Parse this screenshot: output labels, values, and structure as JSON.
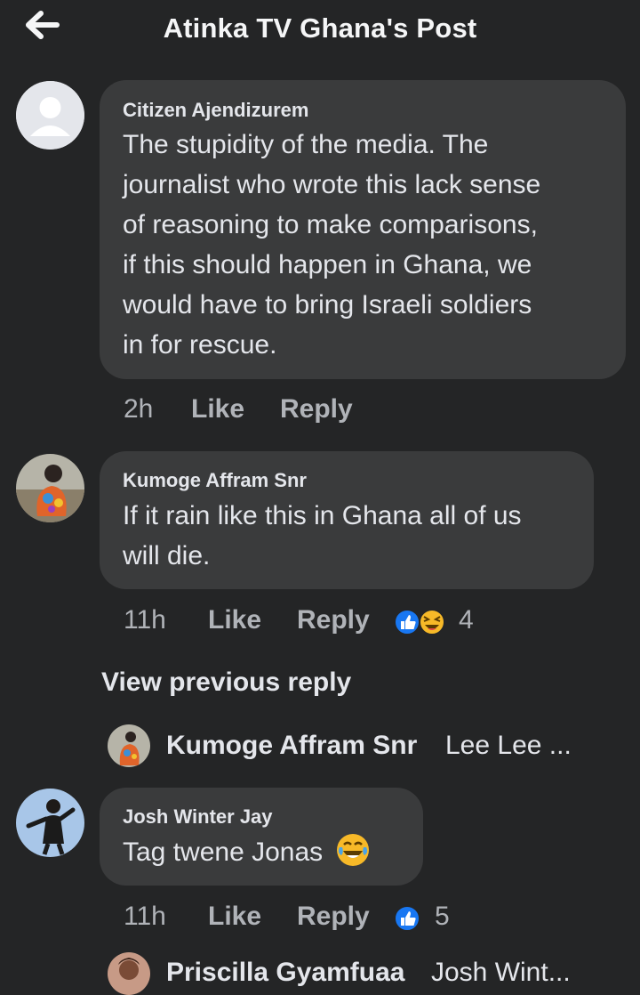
{
  "header": {
    "title": "Atinka TV Ghana's Post",
    "back_icon": "arrow-left-icon"
  },
  "comments": [
    {
      "author": "Citizen Ajendizurem",
      "lines": [
        "The stupidity of the media. The",
        "journalist who wrote this lack sense",
        "of reasoning to make comparisons,",
        "if this should happen in Ghana, we",
        "would have to bring Israeli soldiers",
        "in for rescue."
      ],
      "time": "2h",
      "like": "Like",
      "reply": "Reply"
    },
    {
      "author": "Kumoge Affram Snr",
      "lines": [
        "If it rain like this in Ghana all of us",
        "will die."
      ],
      "time": "11h",
      "like": "Like",
      "reply": "Reply",
      "reaction_count": "4"
    },
    {
      "author": "Josh Winter Jay",
      "lines": [
        "Tag twene Jonas"
      ],
      "time": "11h",
      "like": "Like",
      "reply": "Reply",
      "reaction_count": "5"
    }
  ],
  "view_previous": "View previous reply",
  "replies": [
    {
      "author": "Kumoge Affram Snr",
      "text": "Lee Lee ..."
    },
    {
      "author": "Priscilla Gyamfuaa",
      "text": "Josh Wint..."
    }
  ],
  "colors": {
    "background": "#242526",
    "bubble": "#3a3b3c",
    "like_blue": "#1877f2",
    "haha_yellow": "#f7b928"
  }
}
